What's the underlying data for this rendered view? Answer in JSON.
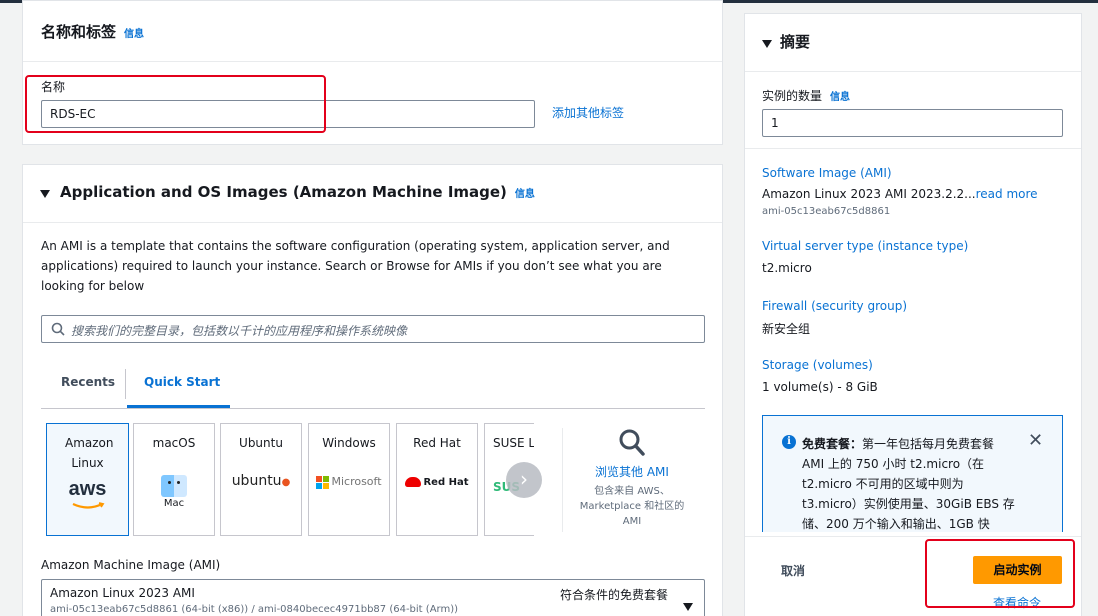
{
  "left": {
    "name_tags": {
      "title": "名称和标签",
      "info": "信息",
      "name_label": "名称",
      "name_value": "RDS-EC",
      "add_tags": "添加其他标签"
    },
    "ami_section": {
      "title": "Application and OS Images (Amazon Machine Image)",
      "info": "信息",
      "description": "An AMI is a template that contains the software configuration (operating system, application server, and applications) required to launch your instance. Search or Browse for AMIs if you don’t see what you are looking for below",
      "search_placeholder": "搜索我们的完整目录，包括数以千计的应用程序和操作系统映像",
      "tabs": [
        "Recents",
        "Quick Start"
      ],
      "active_tab": "Quick Start",
      "tiles": [
        {
          "label": "Amazon Linux",
          "logo": "aws"
        },
        {
          "label": "macOS",
          "logo": "Mac"
        },
        {
          "label": "Ubuntu",
          "logo": "ubuntu"
        },
        {
          "label": "Windows",
          "logo": "Microsoft"
        },
        {
          "label": "Red Hat",
          "logo": "Red Hat"
        },
        {
          "label": "SUSE L",
          "logo": "SUS"
        }
      ],
      "browse_more": "浏览其他 AMI",
      "browse_more_desc": "包含来自 AWS、Marketplace 和社区的 AMI",
      "ami_label": "Amazon Machine Image (AMI)",
      "ami_selected": "Amazon Linux 2023 AMI",
      "ami_free_tier": "符合条件的免费套餐",
      "ami_ids": "ami-05c13eab67c5d8861 (64-bit (x86)) / ami-0840becec4971bb87 (64-bit (Arm))"
    }
  },
  "summary": {
    "title": "摘要",
    "instance_count_label": "实例的数量",
    "info": "信息",
    "instance_count": "1",
    "software_image_label": "Software Image (AMI)",
    "software_image_value": "Amazon Linux 2023 AMI 2023.2.2...",
    "read_more": "read more",
    "ami_id": "ami-05c13eab67c5d8861",
    "instance_type_label": "Virtual server type (instance type)",
    "instance_type_value": "t2.micro",
    "firewall_label": "Firewall (security group)",
    "firewall_value": "新安全组",
    "storage_label": "Storage (volumes)",
    "storage_value": "1 volume(s) - 8 GiB",
    "free_tier_title": "免费套餐：",
    "free_tier_text": "第一年包括每月免费套餐 AMI 上的 750 小时 t2.micro（在 t2.micro 不可用的区域中则为 t3.micro）实例使用量、30GiB EBS 存储、200 万个输入和输出、1GB 快",
    "cancel": "取消",
    "launch": "启动实例",
    "view_commands": "查看命令"
  },
  "colors": {
    "accent": "#0972d3",
    "primary_button": "#ff9900",
    "highlight": "#e3001b"
  }
}
